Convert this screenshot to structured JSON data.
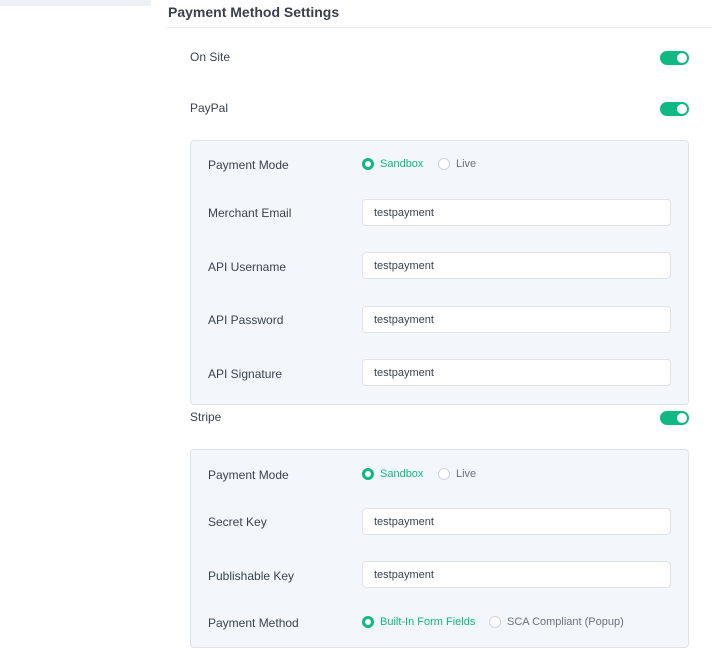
{
  "page": {
    "title": "Payment Method Settings"
  },
  "onsite": {
    "label": "On Site",
    "enabled": true
  },
  "paypal": {
    "label": "PayPal",
    "enabled": true,
    "payment_mode": {
      "label": "Payment Mode",
      "options": [
        "Sandbox",
        "Live"
      ],
      "selected": "Sandbox"
    },
    "merchant_email": {
      "label": "Merchant Email",
      "value": "testpayment"
    },
    "api_username": {
      "label": "API Username",
      "value": "testpayment"
    },
    "api_password": {
      "label": "API Password",
      "value": "testpayment"
    },
    "api_signature": {
      "label": "API Signature",
      "value": "testpayment"
    }
  },
  "stripe": {
    "label": "Stripe",
    "enabled": true,
    "payment_mode": {
      "label": "Payment Mode",
      "options": [
        "Sandbox",
        "Live"
      ],
      "selected": "Sandbox"
    },
    "secret_key": {
      "label": "Secret Key",
      "value": "testpayment"
    },
    "publishable_key": {
      "label": "Publishable Key",
      "value": "testpayment"
    },
    "payment_method": {
      "label": "Payment Method",
      "options": [
        "Built-In Form Fields",
        "SCA Compliant (Popup)"
      ],
      "selected": "Built-In Form Fields"
    }
  },
  "colors": {
    "accent": "#10b981",
    "panel_bg": "#f3f6fa",
    "border": "#dde3ea"
  }
}
